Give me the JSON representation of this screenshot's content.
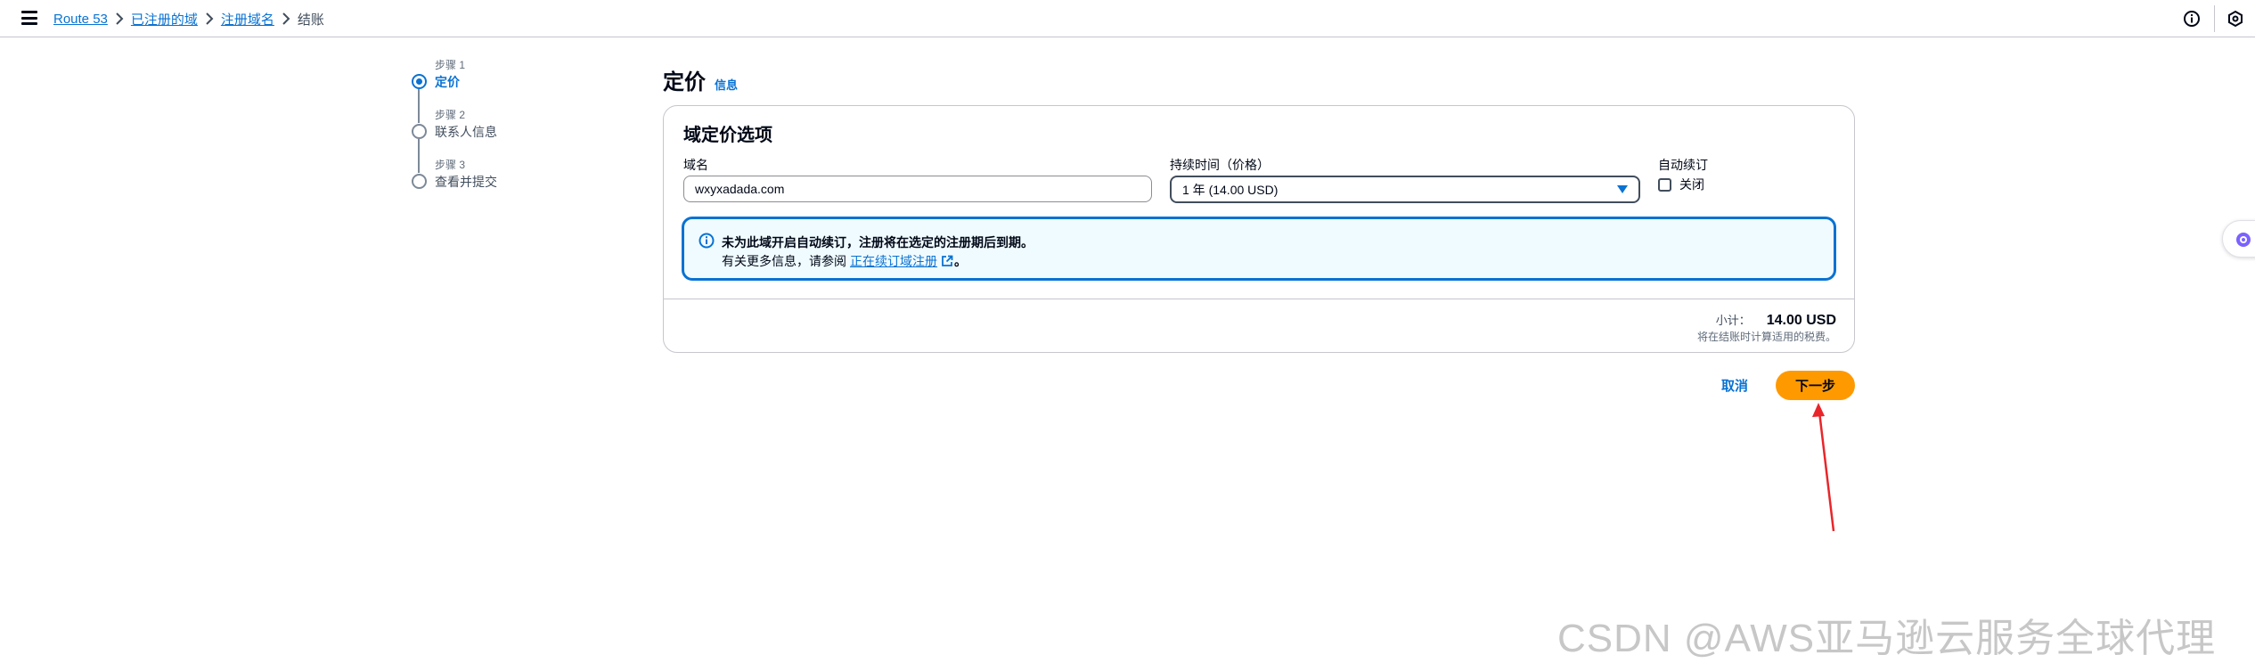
{
  "breadcrumb": {
    "items": [
      "Route 53",
      "已注册的域",
      "注册域名"
    ],
    "current": "结账"
  },
  "steps": [
    {
      "number": "步骤 1",
      "title": "定价"
    },
    {
      "number": "步骤 2",
      "title": "联系人信息"
    },
    {
      "number": "步骤 3",
      "title": "查看并提交"
    }
  ],
  "page": {
    "title": "定价",
    "info_link": "信息"
  },
  "card": {
    "title": "域定价选项",
    "domain_label": "域名",
    "domain_value": "wxyxadada.com",
    "duration_label": "持续时间（价格）",
    "duration_value": "1 年 (14.00 USD)",
    "auto_renew_label": "自动续订",
    "auto_renew_option": "关闭",
    "alert": {
      "title": "未为此域开启自动续订，注册将在选定的注册期后到期。",
      "body_prefix": "有关更多信息，请参阅",
      "link": "正在续订域注册",
      "body_suffix": "。"
    },
    "subtotal_label": "小计：",
    "subtotal_value": "14.00 USD",
    "tax_note": "将在结账时计算适用的税费。"
  },
  "actions": {
    "cancel": "取消",
    "next": "下一步"
  },
  "watermark": "CSDN @AWS亚马逊云服务全球代理",
  "colors": {
    "link": "#0972d3",
    "primary_button": "#ff9900",
    "alert_border": "#0972d3",
    "alert_bg": "#f0fbff",
    "annotation_arrow": "#e8262a"
  }
}
